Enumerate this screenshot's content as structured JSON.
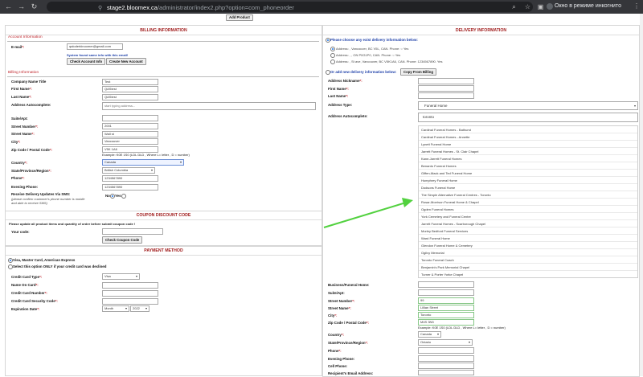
{
  "browser": {
    "url_host": "stage2.bloomex.ca",
    "url_path": "/administrator/index2.php?option=com_phoneorder",
    "incognito_label": "Окно в режиме инкогнито"
  },
  "top": {
    "add_product": "Add Product"
  },
  "billing": {
    "title": "BILLING INFORMATION",
    "account_heading": "Account Information",
    "email_label": "E-mail",
    "email_value": "qaloderkinoomer@gmail.com",
    "found_msg": "System found same info with this email!",
    "check_account_btn": "Check Account Info",
    "create_account_btn": "Create New Account",
    "billing_heading": "Billing Information",
    "fields": {
      "company_label": "Company Name Title",
      "company_value": "Test",
      "first_label": "First Name",
      "first_value": "QAStest",
      "last_label": "Last Name",
      "last_value": "QAStest",
      "autocomplete_label": "Address Autocomplete:",
      "autocomplete_placeholder": "start typing address...",
      "suite_label": "Suite/Apt:",
      "street_num_label": "Street Number",
      "street_num_value": "2001",
      "street_name_label": "Street Name",
      "street_name_value": "Wall st",
      "city_label": "City",
      "city_value": "Vancouver",
      "zip_label": "Zip Code / Postal Code",
      "zip_value": "V5K 1A6",
      "zip_example": "Example: K0E 1S0 (LDL DLD , Where L= letter , D = number)",
      "country_label": "Country",
      "country_value": "Canada",
      "state_label": "State/Province/Region",
      "state_value": "British Columbia",
      "phone_label": "Phone",
      "phone_value": "1234567890",
      "evening_label": "Evening Phone:",
      "evening_value": "1234567890",
      "sms_label": "Receive Delivery Updates Via SMS:",
      "sms_note1": "(please confirm customer's phone number is mobile",
      "sms_note2": "and able to receive SMS)",
      "sms_no": "No",
      "sms_yes": "Yes"
    }
  },
  "coupon": {
    "title": "COUPON DISCOUNT CODE",
    "warning": "Please update all product items and quantity of order before submit coupon code !",
    "code_label": "Your code:",
    "check_btn": "Check Coupon Code"
  },
  "payment": {
    "title": "PAYMENT METHOD",
    "opt1": "Visa, Master Card, American Express",
    "opt2": "Select this option ONLY if your credit card was declined",
    "type_label": "Credit Card Type",
    "type_value": "Visa",
    "name_label": "Name On Card",
    "number_label": "Credit Card Number",
    "cvv_label": "Credit Card Security Code",
    "exp_label": "Expiration Date",
    "exp_month": "Month",
    "exp_year": "2022"
  },
  "delivery": {
    "title": "DELIVERY INFORMATION",
    "choose_label": "Please choose any exist delivery information below:",
    "addr1": "Address: , Vancouver, BC V5L, CAN. Phone: ○ Yes",
    "addr2": "Address: , , ON P0G1P0, CAN. Phone: ○ Yes",
    "addr3": "Address: , St ave, Vancouver, BC V5K1A6, CAN. Phone: 1234567890. Yes",
    "or_add": "Or add new delivery information below:",
    "copy_btn": "Copy From Billing",
    "nickname_label": "Address Nickname",
    "first_label": "First Name",
    "last_label": "Last Name",
    "type_label": "Address Type:",
    "type_value": "Funeral Home",
    "autocomplete_label": "Address Autocomplete:",
    "autocomplete_value": "toronto",
    "suggestions": [
      "Cardinal Funeral Homes - Bathurst",
      "Cardinal Funeral Homes - Annette",
      "Lynett Funeral Home",
      "Jarrett Funeral Homes - St. Clair Chapel",
      "Kane-Jarrett Funeral Homes",
      "Benardo Funeral Homes",
      "Giffen-Mack and Ted Funeral Home",
      "Humphrey Funeral Home",
      "Dodsons Funeral Home",
      "The Simple Alternative Funeral Centres - Toronto",
      "Rosar-Morrison Funeral Home & Chapel",
      "Ogden Funeral Homes",
      "York Cemetery and Funeral Centre",
      "Jarrett Funeral Homes - Scarborough Chapel",
      "Morley Bedford Funeral Services",
      "Ward Funeral Home",
      "Glendon Funeral Home & Cemetery",
      "Ogilvy Memorial",
      "Toronto Funeral Coach",
      "Benjamin's Park Memorial Chapel",
      "Turner & Porter Yorke Chapel"
    ],
    "business_label": "Business/Funeral Home:",
    "suite_label": "Suite/Apt:",
    "street_num_label": "Street Number",
    "street_num_value": "99",
    "street_name_label": "Street Name",
    "street_name_value": "Lillian Street",
    "city_label": "City",
    "city_value": "Toronto",
    "zip_label": "Zip Code / Postal Code",
    "zip_value": "M4S 3N5",
    "zip_example": "Example: K0E 1S0 (LDL DLD , Where L= letter , D = number)",
    "country_label": "Country",
    "country_value": "Canada",
    "state_label": "State/Province/Region",
    "state_value": "Ontario",
    "phone_label": "Phone",
    "evening_label": "Evening Phone:",
    "cell_label": "Cell Phone:",
    "recipient_email_label": "Recipient's Email Address:"
  },
  "colors": {
    "accent_red": "#c0262d",
    "title_red": "#a01c1c",
    "arrow_green": "#52d13f"
  }
}
